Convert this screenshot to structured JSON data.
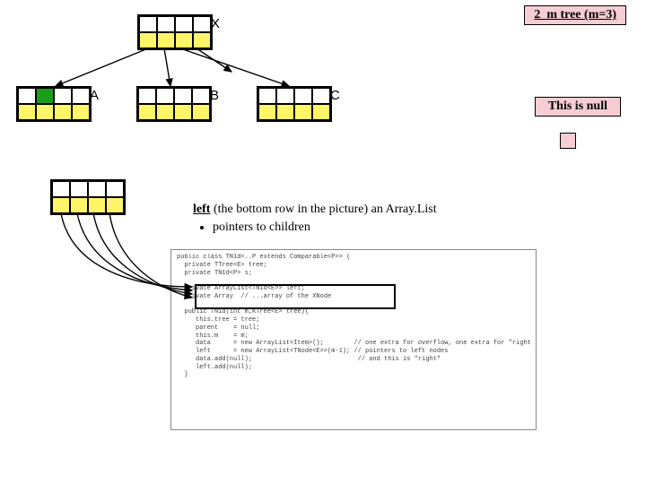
{
  "title": "2_m tree (m=3)",
  "this_is_null": "This is null",
  "nodes": {
    "x": {
      "label": "X"
    },
    "a": {
      "label": "A"
    },
    "b": {
      "label": "B"
    },
    "c": {
      "label": "C"
    }
  },
  "caption": {
    "lead_word": "left",
    "rest": " (the bottom row in the picture) an Array.List",
    "bullet1": "pointers to children"
  },
  "code": {
    "text": "public class TN1d<..P extends Comparable<P>> {\n  private TTree<E> tree;\n  private TN1d<P> s;\n\n  private ArrayList<TN1d<E>> left;\n  private Array  // ...array of the XNode\n\n  public TN1d(int m,KTree<E> tree){\n     this.tree = tree;\n     parent    = null;\n     this.m    = m;\n     data      = new ArrayList<Item>();        // one extra for overflow, one extra for \"right\"\n     left      = new ArrayList<TNode<E>>(m-1); // pointers to left nodes\n     data.add(null);                            // and this is \"right\"\n     left.add(null);\n  }\n"
  },
  "colors": {
    "pink": "#f5cdd2",
    "yellow": "#fff568",
    "green": "#1a9e1a"
  }
}
